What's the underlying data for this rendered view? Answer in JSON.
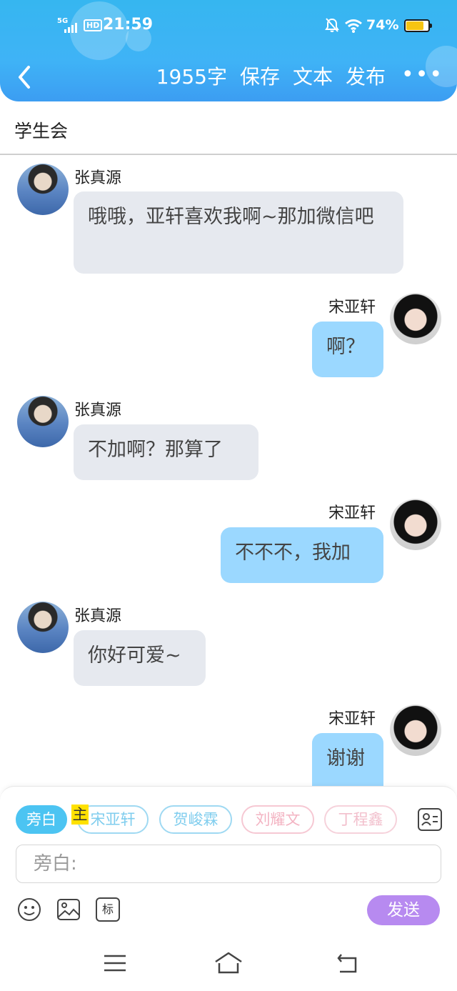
{
  "status_bar": {
    "network": "5G",
    "hd": "HD",
    "time": "21:59",
    "battery_percent": "74%",
    "battery_level": 0.74
  },
  "header": {
    "word_count": "1955字",
    "save_label": "保存",
    "text_label": "文本",
    "publish_label": "发布",
    "more_label": "•••"
  },
  "title": "学生会",
  "messages": [
    {
      "speaker": "张真源",
      "side": "left",
      "text": "哦哦，亚轩喜欢我啊~那加微信吧"
    },
    {
      "speaker": "宋亚轩",
      "side": "right",
      "text": "啊？"
    },
    {
      "speaker": "张真源",
      "side": "left",
      "text": "不加啊？那算了"
    },
    {
      "speaker": "宋亚轩",
      "side": "right",
      "text": "不不不，我加"
    },
    {
      "speaker": "张真源",
      "side": "left",
      "text": "你好可爱~"
    },
    {
      "speaker": "宋亚轩",
      "side": "right",
      "text": "谢谢"
    }
  ],
  "composer": {
    "roles": [
      "旁白",
      "宋亚轩",
      "贺峻霖",
      "刘耀文",
      "丁程鑫"
    ],
    "main_tag": "主",
    "input_placeholder": "旁白:",
    "sticker_label": "标",
    "send_label": "发送"
  },
  "colors": {
    "header_blue": "#3fb3f6",
    "bubble_left": "#e6e9ef",
    "bubble_right": "#9bd8ff",
    "send_button": "#b78af0",
    "active_role": "#4cc4f2"
  }
}
